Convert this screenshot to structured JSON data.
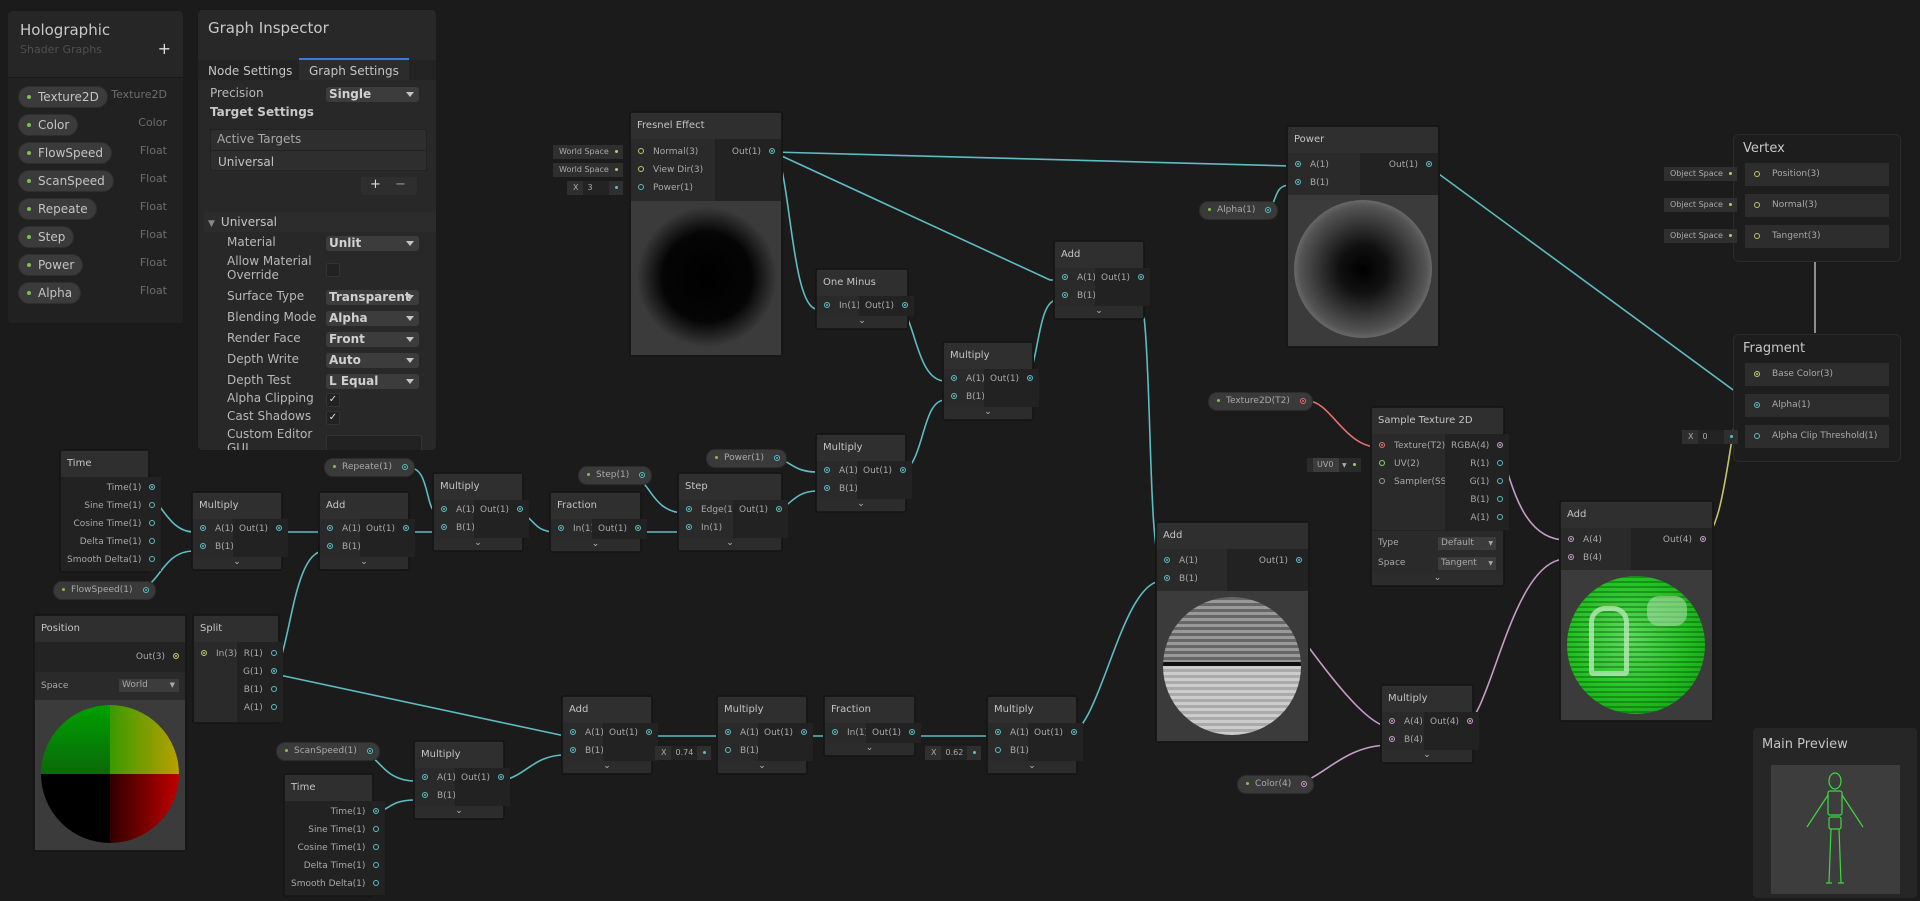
{
  "blackboard": {
    "title": "Holographic",
    "subtitle": "Shader Graphs",
    "add_label": "+",
    "properties": [
      {
        "name": "Texture2D",
        "type": "Texture2D"
      },
      {
        "name": "Color",
        "type": "Color"
      },
      {
        "name": "FlowSpeed",
        "type": "Float"
      },
      {
        "name": "ScanSpeed",
        "type": "Float"
      },
      {
        "name": "Repeate",
        "type": "Float"
      },
      {
        "name": "Step",
        "type": "Float"
      },
      {
        "name": "Power",
        "type": "Float"
      },
      {
        "name": "Alpha",
        "type": "Float"
      }
    ]
  },
  "inspector": {
    "title": "Graph Inspector",
    "tabs": [
      "Node Settings",
      "Graph Settings"
    ],
    "active_tab": "Graph Settings",
    "precision_label": "Precision",
    "precision_value": "Single",
    "target_settings_label": "Target Settings",
    "active_targets_label": "Active Targets",
    "active_targets": [
      "Universal"
    ],
    "add_target": "+",
    "remove_target": "−",
    "universal_section": "Universal",
    "settings": {
      "material": {
        "label": "Material",
        "value": "Unlit"
      },
      "allow_override": {
        "label1": "Allow Material",
        "label2": "Override",
        "checked": false
      },
      "surface_type": {
        "label": "Surface Type",
        "value": "Transparent"
      },
      "blending_mode": {
        "label": "Blending Mode",
        "value": "Alpha"
      },
      "render_face": {
        "label": "Render Face",
        "value": "Front"
      },
      "depth_write": {
        "label": "Depth Write",
        "value": "Auto"
      },
      "depth_test": {
        "label": "Depth Test",
        "value": "L Equal"
      },
      "alpha_clipping": {
        "label": "Alpha Clipping",
        "checked": true,
        "mark": "✓"
      },
      "cast_shadows": {
        "label": "Cast Shadows",
        "checked": true,
        "mark": "✓"
      },
      "custom_editor": {
        "label1": "Custom Editor",
        "label2": "GUI",
        "value": ""
      }
    }
  },
  "nodes": {
    "fresnel": {
      "title": "Fresnel Effect",
      "inputs": [
        "Normal(3)",
        "View Dir(3)",
        "Power(1)"
      ],
      "outputs": [
        "Out(1)"
      ],
      "defaults": [
        "World Space",
        "World Space"
      ],
      "power_x": "X",
      "power_value": "3"
    },
    "one_minus": {
      "title": "One Minus",
      "inputs": [
        "In(1)"
      ],
      "outputs": [
        "Out(1)"
      ]
    },
    "multiply_mid": {
      "title": "Multiply",
      "inputs": [
        "A(1)",
        "B(1)"
      ],
      "outputs": [
        "Out(1)"
      ]
    },
    "add_top": {
      "title": "Add",
      "inputs": [
        "A(1)",
        "B(1)"
      ],
      "outputs": [
        "Out(1)"
      ]
    },
    "power": {
      "title": "Power",
      "inputs": [
        "A(1)",
        "B(1)"
      ],
      "outputs": [
        "Out(1)"
      ]
    },
    "time1": {
      "title": "Time",
      "outputs": [
        "Time(1)",
        "Sine Time(1)",
        "Cosine Time(1)",
        "Delta Time(1)",
        "Smooth Delta(1)"
      ]
    },
    "multiply1": {
      "title": "Multiply",
      "inputs": [
        "A(1)",
        "B(1)"
      ],
      "outputs": [
        "Out(1)"
      ]
    },
    "add1": {
      "title": "Add",
      "inputs": [
        "A(1)",
        "B(1)"
      ],
      "outputs": [
        "Out(1)"
      ]
    },
    "multiply2": {
      "title": "Multiply",
      "inputs": [
        "A(1)",
        "B(1)"
      ],
      "outputs": [
        "Out(1)"
      ]
    },
    "fraction1": {
      "title": "Fraction",
      "inputs": [
        "In(1)"
      ],
      "outputs": [
        "Out(1)"
      ]
    },
    "step": {
      "title": "Step",
      "inputs": [
        "Edge(1)",
        "In(1)"
      ],
      "outputs": [
        "Out(1)"
      ]
    },
    "multiply3": {
      "title": "Multiply",
      "inputs": [
        "A(1)",
        "B(1)"
      ],
      "outputs": [
        "Out(1)"
      ]
    },
    "position": {
      "title": "Position",
      "outputs": [
        "Out(3)"
      ],
      "space_label": "Space",
      "space_value": "World"
    },
    "split": {
      "title": "Split",
      "inputs": [
        "In(3)"
      ],
      "outputs": [
        "R(1)",
        "G(1)",
        "B(1)",
        "A(1)"
      ]
    },
    "multiply4": {
      "title": "Multiply",
      "inputs": [
        "A(1)",
        "B(1)"
      ],
      "outputs": [
        "Out(1)"
      ]
    },
    "time2": {
      "title": "Time",
      "outputs": [
        "Time(1)",
        "Sine Time(1)",
        "Cosine Time(1)",
        "Delta Time(1)",
        "Smooth Delta(1)"
      ]
    },
    "add2": {
      "title": "Add",
      "inputs": [
        "A(1)",
        "B(1)"
      ],
      "outputs": [
        "Out(1)"
      ]
    },
    "multiply5": {
      "title": "Multiply",
      "inputs": [
        "A(1)",
        "B(1)"
      ],
      "outputs": [
        "Out(1)"
      ],
      "b_x": "X",
      "b_value": "0.74"
    },
    "fraction2": {
      "title": "Fraction",
      "inputs": [
        "In(1)"
      ],
      "outputs": [
        "Out(1)"
      ]
    },
    "multiply6": {
      "title": "Multiply",
      "inputs": [
        "A(1)",
        "B(1)"
      ],
      "outputs": [
        "Out(1)"
      ],
      "b_x": "X",
      "b_value": "0.62"
    },
    "add3": {
      "title": "Add",
      "inputs": [
        "A(1)",
        "B(1)"
      ],
      "outputs": [
        "Out(1)"
      ]
    },
    "sample_tex": {
      "title": "Sample Texture 2D",
      "inputs": [
        "Texture(T2)",
        "UV(2)",
        "Sampler(SS)"
      ],
      "outputs": [
        "RGBA(4)",
        "R(1)",
        "G(1)",
        "B(1)",
        "A(1)"
      ],
      "uv_value": "UV0",
      "type_label": "Type",
      "type_value": "Default",
      "space_label": "Space",
      "space_value": "Tangent"
    },
    "multiply7": {
      "title": "Multiply",
      "inputs": [
        "A(4)",
        "B(4)"
      ],
      "outputs": [
        "Out(4)"
      ]
    },
    "add4": {
      "title": "Add",
      "inputs": [
        "A(4)",
        "B(4)"
      ],
      "outputs": [
        "Out(4)"
      ]
    }
  },
  "property_nodes": {
    "alpha": "Alpha(1)",
    "repeate": "Repeate(1)",
    "step": "Step(1)",
    "power": "Power(1)",
    "flowspeed": "FlowSpeed(1)",
    "scanspeed": "ScanSpeed(1)",
    "texture": "Texture2D(T2)",
    "color": "Color(4)"
  },
  "master": {
    "vertex": {
      "title": "Vertex",
      "slots": [
        "Position(3)",
        "Normal(3)",
        "Tangent(3)"
      ],
      "defaults": [
        "Object Space",
        "Object Space",
        "Object Space"
      ]
    },
    "fragment": {
      "title": "Fragment",
      "slots": [
        "Base Color(3)",
        "Alpha(1)",
        "Alpha Clip Threshold(1)"
      ],
      "clip_x": "X",
      "clip_value": "0"
    }
  },
  "main_preview": {
    "title": "Main Preview"
  },
  "colors": {
    "float_wire": "#5ebcc4",
    "vector3_wire": "#c4c46a",
    "vector4_wire": "#c89cc8",
    "texture_wire": "#e2716c",
    "vector2_wire": "#8fd36c",
    "accent_tab": "#3a7bd5"
  }
}
